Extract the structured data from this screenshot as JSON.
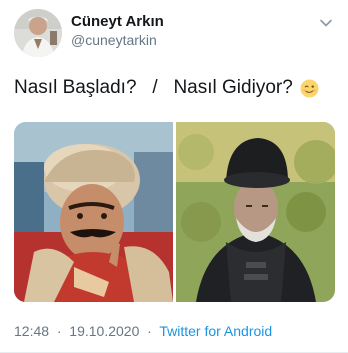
{
  "author": {
    "display_name": "Cüneyt Arkın",
    "handle": "@cuneytarkin"
  },
  "tweet": {
    "text": "Nasıl Başladı?   /   Nasıl Gidiyor?",
    "emoji": "wink-emoji"
  },
  "media": [
    {
      "icon": "photo-warrior-fur-hat"
    },
    {
      "icon": "photo-old-man-black-turban"
    }
  ],
  "meta": {
    "time": "12:48",
    "date": "19.10.2020",
    "dot": "·",
    "source": "Twitter for Android"
  },
  "colors": {
    "text": "#14171a",
    "secondary": "#657786",
    "link": "#1b95e0"
  }
}
